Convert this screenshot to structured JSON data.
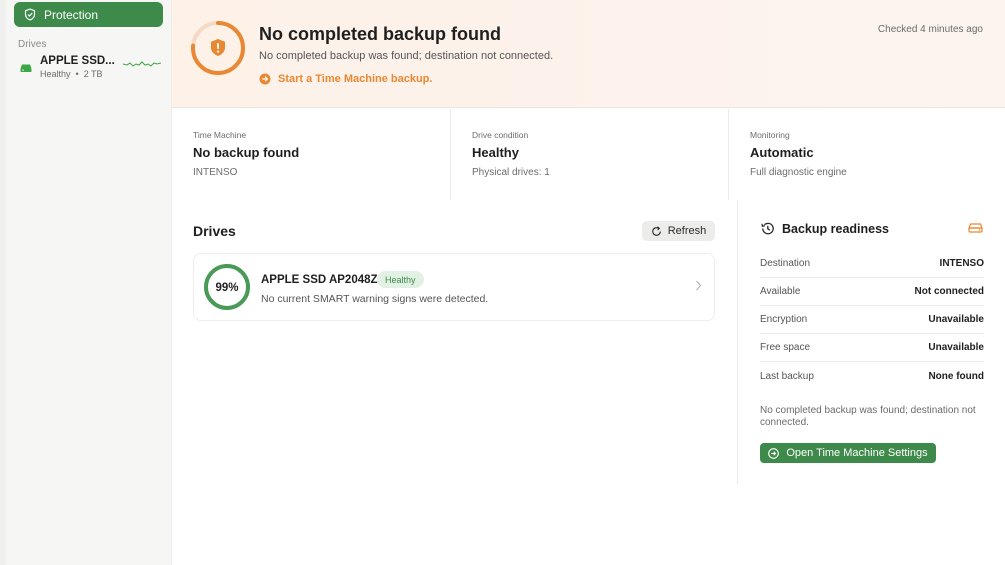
{
  "sidebar": {
    "protection_label": "Protection",
    "drives_section": "Drives",
    "drive": {
      "name": "APPLE SSD...",
      "status": "Healthy",
      "separator": "•",
      "size": "2 TB",
      "icon": "disk-icon"
    }
  },
  "banner": {
    "title": "No completed backup found",
    "description": "No completed backup was found; destination not connected.",
    "action_label": "Start a Time Machine backup.",
    "checked": "Checked 4 minutes ago",
    "accent_color": "#e98832",
    "icon": "shield-warning-icon"
  },
  "stats": [
    {
      "label": "Time Machine",
      "value": "No backup found",
      "sub": "INTENSO"
    },
    {
      "label": "Drive condition",
      "value": "Healthy",
      "sub": "Physical drives: 1"
    },
    {
      "label": "Monitoring",
      "value": "Automatic",
      "sub": "Full diagnostic engine"
    }
  ],
  "drives": {
    "title": "Drives",
    "refresh_label": "Refresh",
    "items": [
      {
        "health_percent": 99,
        "health_label": "99%",
        "name": "APPLE SSD AP2048Z",
        "badge": "Healthy",
        "description": "No current SMART warning signs were detected."
      }
    ]
  },
  "readiness": {
    "title": "Backup readiness",
    "rows": [
      {
        "key": "Destination",
        "value": "INTENSO"
      },
      {
        "key": "Available",
        "value": "Not connected"
      },
      {
        "key": "Encryption",
        "value": "Unavailable"
      },
      {
        "key": "Free space",
        "value": "Unavailable"
      },
      {
        "key": "Last backup",
        "value": "None found"
      }
    ],
    "note": "No completed backup was found; destination not connected.",
    "button_label": "Open Time Machine Settings"
  },
  "colors": {
    "brand_green": "#3d8a4a",
    "warning_orange": "#e98832",
    "healthy_green": "#3d8a4a"
  }
}
